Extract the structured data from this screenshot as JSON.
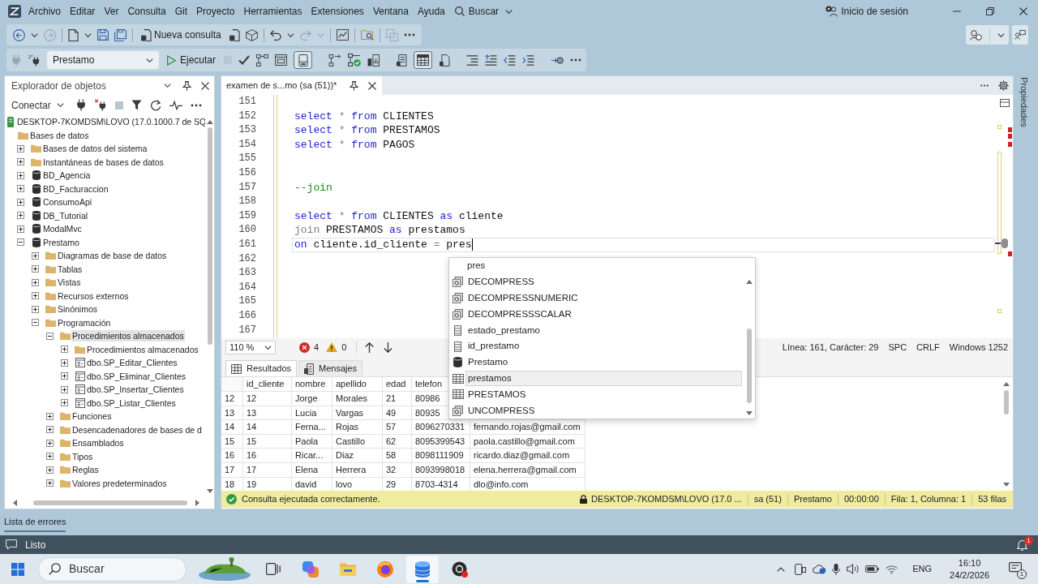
{
  "menu_bar": {
    "items": [
      "Archivo",
      "Editar",
      "Ver",
      "Consulta",
      "Git",
      "Proyecto",
      "Herramientas",
      "Extensiones",
      "Ventana",
      "Ayuda"
    ],
    "search": "Buscar",
    "account": "Inicio de sesión"
  },
  "toolbar_main": {
    "items": [
      {
        "kind": "back",
        "disabled": false
      },
      {
        "kind": "dropdown",
        "disabled": false
      },
      {
        "kind": "forward",
        "disabled": true
      },
      {
        "kind": "separator"
      },
      {
        "kind": "new_file",
        "disabled": false
      },
      {
        "kind": "dropdown",
        "disabled": false
      },
      {
        "kind": "save",
        "disabled": false
      },
      {
        "kind": "save_all",
        "disabled": false
      },
      {
        "kind": "separator"
      },
      {
        "kind": "new_query",
        "label": "Nueva consulta",
        "disabled": false
      },
      {
        "kind": "database_file",
        "disabled": false
      },
      {
        "kind": "cube",
        "disabled": false
      },
      {
        "kind": "separator"
      },
      {
        "kind": "undo",
        "disabled": false
      },
      {
        "kind": "dropdown",
        "disabled": false
      },
      {
        "kind": "redo",
        "disabled": true
      },
      {
        "kind": "dropdown",
        "disabled": true
      },
      {
        "kind": "separator"
      },
      {
        "kind": "monitor",
        "disabled": false
      },
      {
        "kind": "separator"
      },
      {
        "kind": "folder_search",
        "disabled": false
      },
      {
        "kind": "separator"
      },
      {
        "kind": "copy",
        "disabled": true
      },
      {
        "kind": "more",
        "disabled": false
      }
    ]
  },
  "toolbar_sql": {
    "items": [
      {
        "kind": "plug",
        "disabled": true,
        "pressed": false
      },
      {
        "kind": "plug_change",
        "disabled": false,
        "pressed": false
      },
      {
        "kind": "database",
        "label": "Prestamo"
      },
      {
        "kind": "execute",
        "label": "Ejecutar",
        "disabled": false
      },
      {
        "kind": "stop",
        "disabled": true,
        "pressed": false
      },
      {
        "kind": "check",
        "disabled": false,
        "pressed": false
      },
      {
        "kind": "plan",
        "disabled": false,
        "pressed": false
      },
      {
        "kind": "window",
        "disabled": false,
        "pressed": false
      },
      {
        "kind": "pane",
        "disabled": false,
        "pressed": true
      },
      {
        "kind": "gap"
      },
      {
        "kind": "plan_arrow",
        "disabled": false,
        "pressed": false
      },
      {
        "kind": "plan_check",
        "disabled": false,
        "pressed": false
      },
      {
        "kind": "stats",
        "disabled": false,
        "pressed": false
      },
      {
        "kind": "gap"
      },
      {
        "kind": "to_text",
        "disabled": false,
        "pressed": false
      },
      {
        "kind": "to_grid",
        "disabled": false,
        "pressed": true
      },
      {
        "kind": "to_file",
        "disabled": false,
        "pressed": false
      },
      {
        "kind": "gap"
      },
      {
        "kind": "comment",
        "disabled": false,
        "pressed": false
      },
      {
        "kind": "uncomment",
        "disabled": false,
        "pressed": false
      },
      {
        "kind": "outdent",
        "disabled": false,
        "pressed": false
      },
      {
        "kind": "indent",
        "disabled": false,
        "pressed": false
      },
      {
        "kind": "gap"
      },
      {
        "kind": "parameters",
        "disabled": false,
        "pressed": false
      },
      {
        "kind": "more",
        "disabled": false,
        "pressed": false
      }
    ]
  },
  "object_explorer": {
    "title": "Explorador de objetos",
    "connect": "Conectar",
    "toolbar": [
      {
        "kind": "plug",
        "disabled": false
      },
      {
        "kind": "disconnect",
        "disabled": false
      },
      {
        "kind": "stop",
        "disabled": true
      },
      {
        "kind": "filter",
        "disabled": false
      },
      {
        "kind": "refresh",
        "disabled": false
      },
      {
        "kind": "activity",
        "disabled": false
      },
      {
        "kind": "more",
        "disabled": false
      }
    ],
    "tree": [
      {
        "kind": "server",
        "label": "DESKTOP-7KOMDSM\\LOVO (17.0.1000.7 de SQ",
        "selected": false,
        "children": [
          {
            "kind": "folder",
            "label": "Bases de datos",
            "selected": false,
            "children": [
              {
                "kind": "folder",
                "label": "Bases de datos del sistema",
                "expanded": false,
                "selected": false
              },
              {
                "kind": "folder",
                "label": "Instantáneas de bases de datos",
                "expanded": false,
                "selected": false
              },
              {
                "kind": "database",
                "label": "BD_Agencia",
                "expanded": false,
                "selected": false
              },
              {
                "kind": "database",
                "label": "BD_Facturaccion",
                "expanded": false,
                "selected": false
              },
              {
                "kind": "database",
                "label": "ConsumoApi",
                "expanded": false,
                "selected": false
              },
              {
                "kind": "database",
                "label": "DB_Tutorial",
                "expanded": false,
                "selected": false
              },
              {
                "kind": "database",
                "label": "ModalMvc",
                "expanded": false,
                "selected": false
              },
              {
                "kind": "database",
                "label": "Prestamo",
                "expanded": true,
                "selected": false,
                "children": [
                  {
                    "kind": "folder",
                    "label": "Diagramas de base de datos",
                    "expanded": false,
                    "selected": false
                  },
                  {
                    "kind": "folder",
                    "label": "Tablas",
                    "expanded": false,
                    "selected": false
                  },
                  {
                    "kind": "folder",
                    "label": "Vistas",
                    "expanded": false,
                    "selected": false
                  },
                  {
                    "kind": "folder",
                    "label": "Recursos externos",
                    "expanded": false,
                    "selected": false
                  },
                  {
                    "kind": "folder",
                    "label": "Sinónimos",
                    "expanded": false,
                    "selected": false
                  },
                  {
                    "kind": "folder",
                    "label": "Programación",
                    "expanded": true,
                    "selected": false,
                    "children": [
                      {
                        "kind": "folder",
                        "label": "Procedimientos almacenados",
                        "expanded": true,
                        "selected": true,
                        "children": [
                          {
                            "kind": "folder",
                            "label": "Procedimientos almacenados",
                            "expanded": false,
                            "selected": false
                          },
                          {
                            "kind": "procedure",
                            "label": "dbo.SP_Editar_Clientes",
                            "expanded": false,
                            "selected": false
                          },
                          {
                            "kind": "procedure",
                            "label": "dbo.SP_Eliminar_Clientes",
                            "expanded": false,
                            "selected": false
                          },
                          {
                            "kind": "procedure",
                            "label": "dbo.SP_Insertar_Clientes",
                            "expanded": false,
                            "selected": false
                          },
                          {
                            "kind": "procedure",
                            "label": "dbo.SP_Listar_Clientes",
                            "expanded": false,
                            "selected": false
                          }
                        ]
                      },
                      {
                        "kind": "folder",
                        "label": "Funciones",
                        "expanded": false,
                        "selected": false
                      },
                      {
                        "kind": "folder",
                        "label": "Desencadenadores de bases de d",
                        "expanded": false,
                        "selected": false
                      },
                      {
                        "kind": "folder",
                        "label": "Ensamblados",
                        "expanded": false,
                        "selected": false
                      },
                      {
                        "kind": "folder",
                        "label": "Tipos",
                        "expanded": false,
                        "selected": false
                      },
                      {
                        "kind": "folder",
                        "label": "Reglas",
                        "expanded": false,
                        "selected": false
                      },
                      {
                        "kind": "folder",
                        "label": "Valores predeterminados",
                        "expanded": false,
                        "selected": false
                      }
                    ]
                  }
                ]
              }
            ]
          }
        ]
      }
    ]
  },
  "editor": {
    "tab": {
      "title": "examen de s...mo (sa (51))*",
      "selected": true
    },
    "lines": [
      {
        "number": "151",
        "current": false
      },
      {
        "number": "152",
        "current": false,
        "tokens": [
          {
            "kind": "keyword",
            "text": "select"
          },
          {
            "kind": "operator",
            "text": "*"
          },
          {
            "kind": "keyword",
            "text": "from"
          },
          {
            "kind": "text",
            "text": "CLIENTES"
          }
        ]
      },
      {
        "number": "153",
        "current": false,
        "tokens": [
          {
            "kind": "keyword",
            "text": "select"
          },
          {
            "kind": "operator",
            "text": "*"
          },
          {
            "kind": "keyword",
            "text": "from"
          },
          {
            "kind": "text",
            "text": "PRESTAMOS"
          }
        ]
      },
      {
        "number": "154",
        "current": false,
        "tokens": [
          {
            "kind": "keyword",
            "text": "select"
          },
          {
            "kind": "operator",
            "text": "*"
          },
          {
            "kind": "keyword",
            "text": "from"
          },
          {
            "kind": "text",
            "text": "PAGOS"
          }
        ]
      },
      {
        "number": "155",
        "current": false
      },
      {
        "number": "156",
        "current": false
      },
      {
        "number": "157",
        "current": false,
        "tokens": [
          {
            "kind": "comment",
            "text": "--join"
          }
        ]
      },
      {
        "number": "158",
        "current": false
      },
      {
        "number": "159",
        "current": false,
        "tokens": [
          {
            "kind": "keyword",
            "text": "select"
          },
          {
            "kind": "operator",
            "text": "*"
          },
          {
            "kind": "keyword",
            "text": "from"
          },
          {
            "kind": "text",
            "text": "CLIENTES"
          },
          {
            "kind": "keyword",
            "text": "as"
          },
          {
            "kind": "text",
            "text": "cliente"
          }
        ]
      },
      {
        "number": "160",
        "current": false,
        "tokens": [
          {
            "kind": "operator",
            "text": "join"
          },
          {
            "kind": "text",
            "text": "PRESTAMOS"
          },
          {
            "kind": "keyword",
            "text": "as"
          },
          {
            "kind": "text",
            "text": "prestamos"
          }
        ]
      },
      {
        "number": "161",
        "current": true,
        "tokens": [
          {
            "kind": "keyword",
            "text": "on"
          },
          {
            "kind": "text",
            "text": "cliente.id_cliente"
          },
          {
            "kind": "operator",
            "text": "="
          },
          {
            "kind": "text",
            "text": "pres"
          }
        ]
      },
      {
        "number": "162",
        "current": false
      },
      {
        "number": "163",
        "current": false
      },
      {
        "number": "164",
        "current": false
      },
      {
        "number": "165",
        "current": false
      },
      {
        "number": "166",
        "current": false
      },
      {
        "number": "167",
        "current": false
      }
    ],
    "autocomplete": {
      "filter": "pres",
      "items": [
        {
          "kind": "function",
          "label": "DECOMPRESS",
          "selected": false
        },
        {
          "kind": "function",
          "label": "DECOMPRESSNUMERIC",
          "selected": false
        },
        {
          "kind": "function",
          "label": "DECOMPRESSSCALAR",
          "selected": false
        },
        {
          "kind": "column",
          "label": "estado_prestamo",
          "selected": false
        },
        {
          "kind": "column",
          "label": "id_prestamo",
          "selected": false
        },
        {
          "kind": "database",
          "label": "Prestamo",
          "selected": false
        },
        {
          "kind": "table",
          "label": "prestamos",
          "selected": true
        },
        {
          "kind": "table",
          "label": "PRESTAMOS",
          "selected": false
        },
        {
          "kind": "function",
          "label": "UNCOMPRESS",
          "selected": false
        }
      ]
    },
    "status": {
      "zoom": "110 %",
      "errors": "4",
      "warnings": "0",
      "position": "Línea: 161, Carácter: 29",
      "whitespace": "SPC",
      "line_endings": "CRLF",
      "encoding": "Windows 1252"
    }
  },
  "properties_tab": "Propiedades",
  "results": {
    "tabs": [
      {
        "label": "Resultados",
        "selected": true
      },
      {
        "label": "Mensajes",
        "selected": false
      }
    ],
    "columns": [
      "id_cliente",
      "nombre",
      "apellido",
      "edad",
      "telefon"
    ],
    "rows": [
      {
        "number": "12",
        "cells": [
          "12",
          "Jorge",
          "Morales",
          "21",
          "80986"
        ]
      },
      {
        "number": "13",
        "cells": [
          "13",
          "Lucia",
          "Vargas",
          "49",
          "80935"
        ]
      },
      {
        "number": "14",
        "cells": [
          "14",
          "Ferna...",
          "Rojas",
          "57",
          "8096270331",
          "fernando.rojas@gmail.com"
        ]
      },
      {
        "number": "15",
        "cells": [
          "15",
          "Paola",
          "Castillo",
          "62",
          "8095399543",
          "paola.castillo@gmail.com"
        ]
      },
      {
        "number": "16",
        "cells": [
          "16",
          "Ricar...",
          "Diaz",
          "58",
          "8098111909",
          "ricardo.diaz@gmail.com"
        ]
      },
      {
        "number": "17",
        "cells": [
          "17",
          "Elena",
          "Herrera",
          "32",
          "8093998018",
          "elena.herrera@gmail.com"
        ]
      },
      {
        "number": "18",
        "cells": [
          "19",
          "david",
          "lovo",
          "29",
          "8703-4314",
          "dlo@info.com"
        ]
      }
    ]
  },
  "query_status": {
    "message": "Consulta ejecutada correctamente.",
    "server": "DESKTOP-7KOMDSM\\LOVO (17.0 ...",
    "user": "sa (51)",
    "database": "Prestamo",
    "elapsed": "00:00:00",
    "position": "Fila: 1, Columna: 1",
    "row_count": "53 filas"
  },
  "bottom_tabs": [
    {
      "label": "Lista de errores",
      "selected": true
    }
  ],
  "status_bar": {
    "text": "Listo",
    "notification_count": "1"
  },
  "taskbar": {
    "search_placeholder": "Buscar",
    "apps": [
      {
        "kind": "task_view",
        "selected": false
      },
      {
        "kind": "copilot",
        "selected": false
      },
      {
        "kind": "file_explorer",
        "selected": false
      },
      {
        "kind": "browser",
        "selected": false
      },
      {
        "kind": "ssms",
        "selected": true
      },
      {
        "kind": "recorder",
        "selected": false
      }
    ],
    "language": "ENG",
    "time": "16:10",
    "date": "24/2/2026",
    "notification_count": "1"
  }
}
